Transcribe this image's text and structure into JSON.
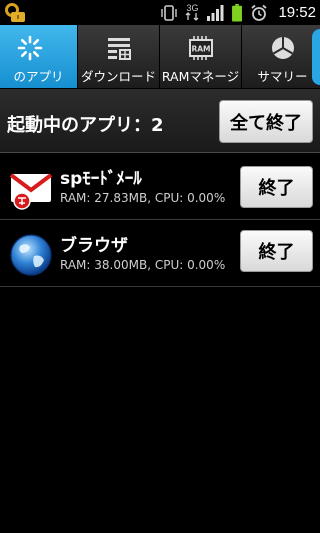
{
  "status_bar": {
    "time": "19:52",
    "network_label": "3G",
    "icons": [
      "lock-icon",
      "vibrate-icon",
      "3g-data-icon",
      "signal-icon",
      "battery-icon",
      "alarm-icon"
    ]
  },
  "tabs": [
    {
      "label": "のアプリ",
      "icon": "running-spinner-icon",
      "active": true
    },
    {
      "label": "ダウンロード",
      "icon": "download-list-icon",
      "active": false
    },
    {
      "label": "RAMマネージ",
      "icon": "ram-chip-icon",
      "active": false
    },
    {
      "label": "サマリー",
      "icon": "pie-chart-icon",
      "active": false
    }
  ],
  "header": {
    "running_label": "起動中のアプリ：2",
    "quit_all_label": "全て終了"
  },
  "apps": [
    {
      "name": "spﾓｰﾄﾞﾒｰﾙ",
      "stats": "RAM: 27.83MB, CPU: 0.00%",
      "quit_label": "終了",
      "icon": "spmode-mail-icon"
    },
    {
      "name": "ブラウザ",
      "stats": "RAM: 38.00MB, CPU: 0.00%",
      "quit_label": "終了",
      "icon": "browser-globe-icon"
    }
  ],
  "colors": {
    "accent": "#2aa6e4",
    "background": "#000000",
    "battery": "#7ed321"
  }
}
